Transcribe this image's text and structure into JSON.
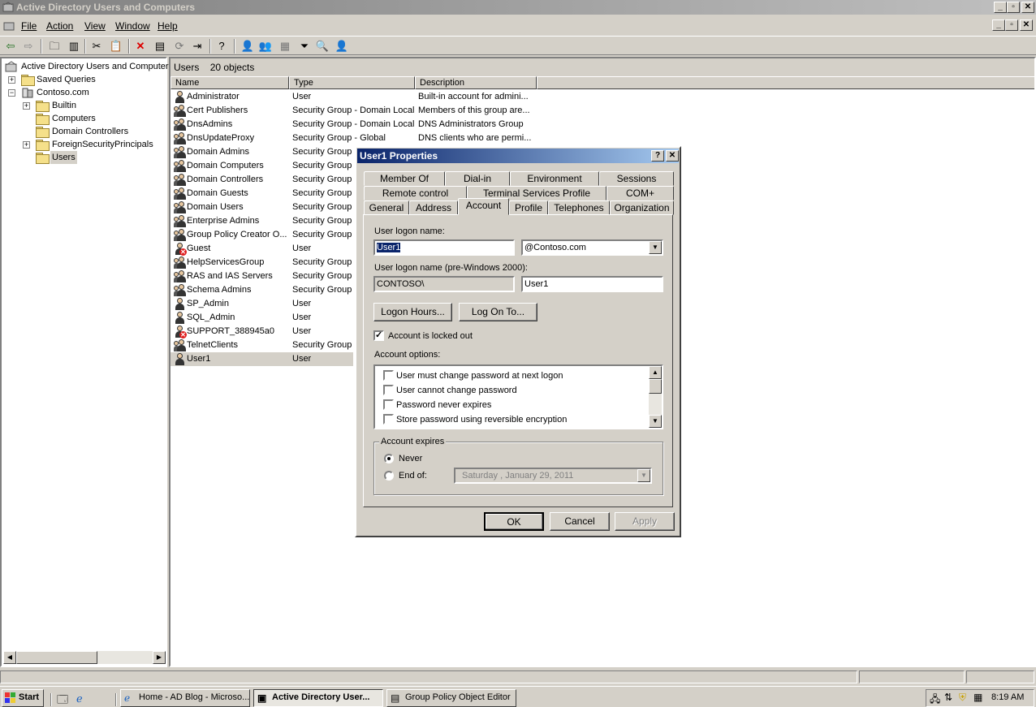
{
  "window": {
    "title": "Active Directory Users and Computers",
    "min": "_",
    "max": "▫",
    "close": "✕"
  },
  "menu": {
    "file": "File",
    "action": "Action",
    "view": "View",
    "window": "Window",
    "help": "Help"
  },
  "toolbar": {
    "icons": [
      "back-icon",
      "forward-icon",
      "up-folder-icon",
      "show-hide-tree-icon",
      "cut-icon",
      "paste-icon",
      "delete-icon",
      "properties-icon",
      "refresh-icon",
      "export-icon",
      "help-icon",
      "new-user-icon",
      "new-group-icon",
      "new-ou-icon",
      "filter-icon",
      "find-icon",
      "add-to-group-icon"
    ]
  },
  "tree": {
    "root": "Active Directory Users and Computer",
    "saved_queries": "Saved Queries",
    "domain": "Contoso.com",
    "children": [
      "Builtin",
      "Computers",
      "Domain Controllers",
      "ForeignSecurityPrincipals",
      "Users"
    ],
    "expand_plus": "+",
    "expand_minus": "−"
  },
  "list": {
    "container": "Users",
    "count": "20 objects",
    "columns": {
      "name": "Name",
      "type": "Type",
      "description": "Description"
    },
    "rows": [
      {
        "name": "Administrator",
        "type": "User",
        "desc": "Built-in account for admini...",
        "kind": "user"
      },
      {
        "name": "Cert Publishers",
        "type": "Security Group - Domain Local",
        "desc": "Members of this group are...",
        "kind": "group"
      },
      {
        "name": "DnsAdmins",
        "type": "Security Group - Domain Local",
        "desc": "DNS Administrators Group",
        "kind": "group"
      },
      {
        "name": "DnsUpdateProxy",
        "type": "Security Group - Global",
        "desc": "DNS clients who are permi...",
        "kind": "group"
      },
      {
        "name": "Domain Admins",
        "type": "Security Group",
        "desc": "",
        "kind": "group"
      },
      {
        "name": "Domain Computers",
        "type": "Security Group",
        "desc": "",
        "kind": "group"
      },
      {
        "name": "Domain Controllers",
        "type": "Security Group",
        "desc": "",
        "kind": "group"
      },
      {
        "name": "Domain Guests",
        "type": "Security Group",
        "desc": "",
        "kind": "group"
      },
      {
        "name": "Domain Users",
        "type": "Security Group",
        "desc": "",
        "kind": "group"
      },
      {
        "name": "Enterprise Admins",
        "type": "Security Group",
        "desc": "",
        "kind": "group"
      },
      {
        "name": "Group Policy Creator O...",
        "type": "Security Group",
        "desc": "",
        "kind": "group"
      },
      {
        "name": "Guest",
        "type": "User",
        "desc": "",
        "kind": "disabled"
      },
      {
        "name": "HelpServicesGroup",
        "type": "Security Group",
        "desc": "",
        "kind": "group"
      },
      {
        "name": "RAS and IAS Servers",
        "type": "Security Group",
        "desc": "",
        "kind": "group"
      },
      {
        "name": "Schema Admins",
        "type": "Security Group",
        "desc": "",
        "kind": "group"
      },
      {
        "name": "SP_Admin",
        "type": "User",
        "desc": "",
        "kind": "user"
      },
      {
        "name": "SQL_Admin",
        "type": "User",
        "desc": "",
        "kind": "user"
      },
      {
        "name": "SUPPORT_388945a0",
        "type": "User",
        "desc": "",
        "kind": "disabled"
      },
      {
        "name": "TelnetClients",
        "type": "Security Group",
        "desc": "",
        "kind": "group"
      },
      {
        "name": "User1",
        "type": "User",
        "desc": "",
        "kind": "user"
      }
    ]
  },
  "dialog": {
    "title": "User1 Properties",
    "help": "?",
    "close": "✕",
    "tabs_row1": [
      "Member Of",
      "Dial-in",
      "Environment",
      "Sessions"
    ],
    "tabs_row2": [
      "Remote control",
      "Terminal Services Profile",
      "COM+"
    ],
    "tabs_row3": [
      "General",
      "Address",
      "Account",
      "Profile",
      "Telephones",
      "Organization"
    ],
    "selected_tab": "Account",
    "logon_name_label": "User logon name:",
    "logon_name_value": "User1",
    "upn_suffix": "@Contoso.com",
    "pre2000_label": "User logon name (pre-Windows 2000):",
    "pre2000_domain": "CONTOSO\\",
    "pre2000_value": "User1",
    "logon_hours_btn": "Logon Hours...",
    "logon_to_btn": "Log On To...",
    "locked_out_label": "Account is locked out",
    "locked_out_checked": true,
    "check_mark": "✓",
    "options_label": "Account options:",
    "options": [
      {
        "label": "User must change password at next logon",
        "checked": false
      },
      {
        "label": "User cannot change password",
        "checked": false
      },
      {
        "label": "Password never expires",
        "checked": false
      },
      {
        "label": "Store password using reversible encryption",
        "checked": false
      }
    ],
    "expires_group": "Account expires",
    "never_label": "Never",
    "end_of_label": "End of:",
    "end_of_date": "Saturday  ,   January  29, 2011",
    "ok": "OK",
    "cancel": "Cancel",
    "apply": "Apply"
  },
  "taskbar": {
    "start": "Start",
    "items": [
      "Home - AD Blog - Microso...",
      "Active Directory User...",
      "Group Policy Object Editor"
    ],
    "clock": "8:19 AM"
  }
}
